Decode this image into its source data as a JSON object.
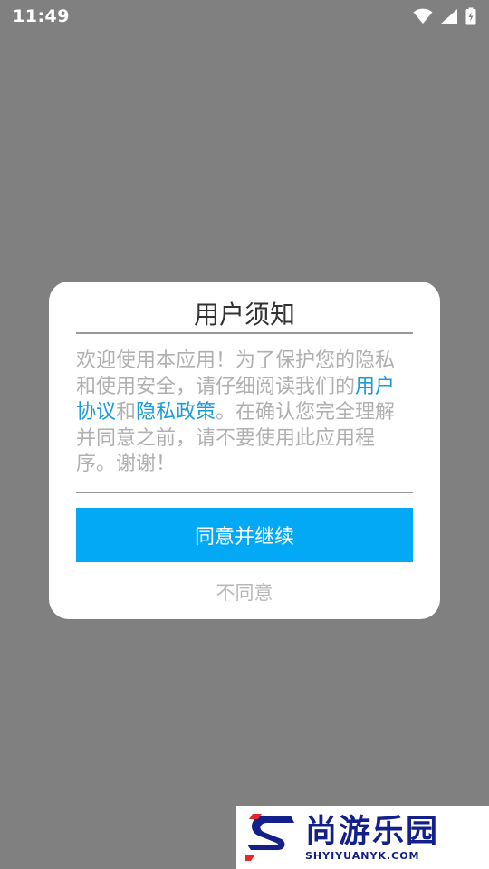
{
  "status_bar": {
    "time": "11:49",
    "icons": [
      "wifi-icon",
      "signal-icon",
      "battery-charging-icon"
    ]
  },
  "dialog": {
    "title": "用户须知",
    "body": {
      "text_1": "欢迎使用本应用！为了保护您的隐私和使用安全，请仔细阅读我们的",
      "link_user_agreement": "用户协议",
      "text_2": "和",
      "link_privacy_policy": "隐私政策",
      "text_3": "。在确认您完全理解并同意之前，请不要使用此应用程序。谢谢！"
    },
    "agree_label": "同意并继续",
    "disagree_label": "不同意"
  },
  "watermark": {
    "text_cn": "尚游乐园",
    "text_en": "SHYIYUANYK.COM"
  },
  "colors": {
    "overlay": "#808080",
    "accent": "#03a9f4",
    "link": "#1a9cd9",
    "watermark": "#14208a"
  }
}
